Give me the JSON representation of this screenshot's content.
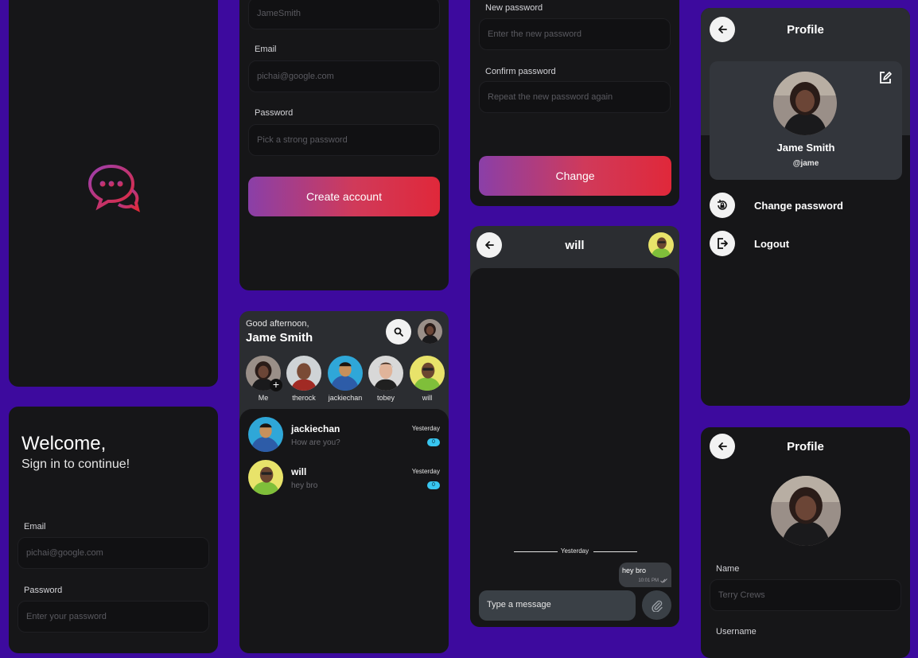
{
  "colors": {
    "background": "#3d0a9e",
    "card": "#161618",
    "accent_start": "#8a3fa8",
    "accent_end": "#e0283a",
    "badge": "#38c6f0"
  },
  "signup": {
    "username_value": "JameSmith",
    "email_label": "Email",
    "email_placeholder": "pichai@google.com",
    "password_label": "Password",
    "password_placeholder": "Pick a strong password",
    "create_button": "Create account"
  },
  "change_password": {
    "new_label": "New password",
    "new_placeholder": "Enter the new password",
    "confirm_label": "Confirm password",
    "confirm_placeholder": "Repeat the new password again",
    "change_button": "Change"
  },
  "profile": {
    "title": "Profile",
    "name": "Jame Smith",
    "handle": "@jame",
    "menu": [
      {
        "label": "Change password",
        "icon": "lock-reset-icon"
      },
      {
        "label": "Logout",
        "icon": "logout-icon"
      }
    ]
  },
  "login": {
    "welcome": "Welcome,",
    "subtitle": "Sign in to continue!",
    "email_label": "Email",
    "email_placeholder": "pichai@google.com",
    "password_label": "Password",
    "password_placeholder": "Enter your password"
  },
  "home": {
    "greeting": "Good afternoon,",
    "user_name": "Jame Smith",
    "stories": [
      "Me",
      "therock",
      "jackiechan",
      "tobey",
      "will"
    ],
    "chats": [
      {
        "name": "jackiechan",
        "message": "How are you?",
        "time": "Yesterday",
        "unread": "0"
      },
      {
        "name": "will",
        "message": "hey bro",
        "time": "Yesterday",
        "unread": "0"
      }
    ]
  },
  "chat": {
    "title": "will",
    "divider": "Yesterday",
    "bubble_text": "hey bro",
    "bubble_time": "10:01 PM",
    "input_placeholder": "Type a message"
  },
  "edit_profile": {
    "title": "Profile",
    "name_label": "Name",
    "name_placeholder": "Terry Crews",
    "username_label": "Username"
  }
}
